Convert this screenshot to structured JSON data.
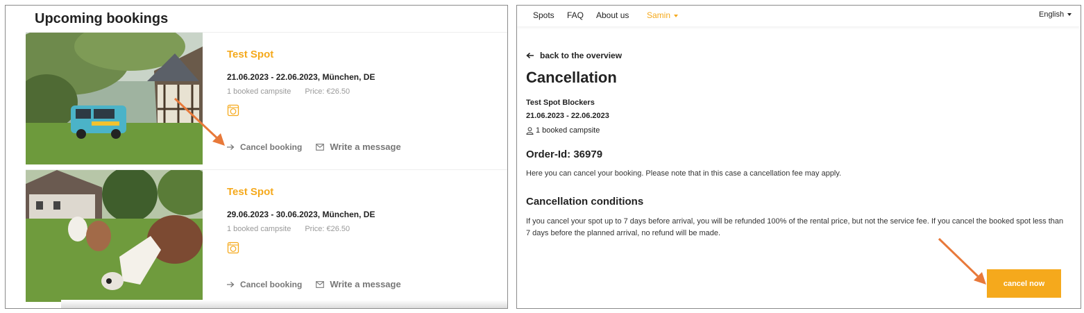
{
  "left_panel": {
    "section_title": "Upcoming bookings",
    "bookings": [
      {
        "spot_name": "Test Spot",
        "dates": "21.06.2023 - 22.06.2023, München, DE",
        "campsites": "1 booked campsite",
        "price": "Price: €26.50",
        "amenity_icon": "washing-machine-icon",
        "cancel_label": "Cancel booking",
        "message_label": "Write a message"
      },
      {
        "spot_name": "Test Spot",
        "dates": "29.06.2023 - 30.06.2023, München, DE",
        "campsites": "1 booked campsite",
        "price": "Price: €26.50",
        "amenity_icon": "washing-machine-icon",
        "cancel_label": "Cancel booking",
        "message_label": "Write a message"
      }
    ]
  },
  "right_panel": {
    "nav": {
      "items": [
        "Spots",
        "FAQ",
        "About us"
      ],
      "user": "Samin",
      "language": "English"
    },
    "back_link": "back to the overview",
    "page_title": "Cancellation",
    "spot_title": "Test Spot Blockers",
    "date_range": "21.06.2023 - 22.06.2023",
    "campsites": "1 booked campsite",
    "order_id": "Order-Id: 36979",
    "notice": "Here you can cancel your booking. Please note that in this case a cancellation fee may apply.",
    "conditions_title": "Cancellation conditions",
    "conditions_text": "If you cancel your spot up to 7 days before arrival, you will be refunded 100% of the rental price, but not the service fee. If you cancel the booked spot less than 7 days before the planned arrival, no refund will be made.",
    "cancel_button": "cancel now"
  },
  "colors": {
    "accent": "#f5a91c",
    "annotation_arrow": "#e8793a",
    "muted_text": "#999999"
  }
}
